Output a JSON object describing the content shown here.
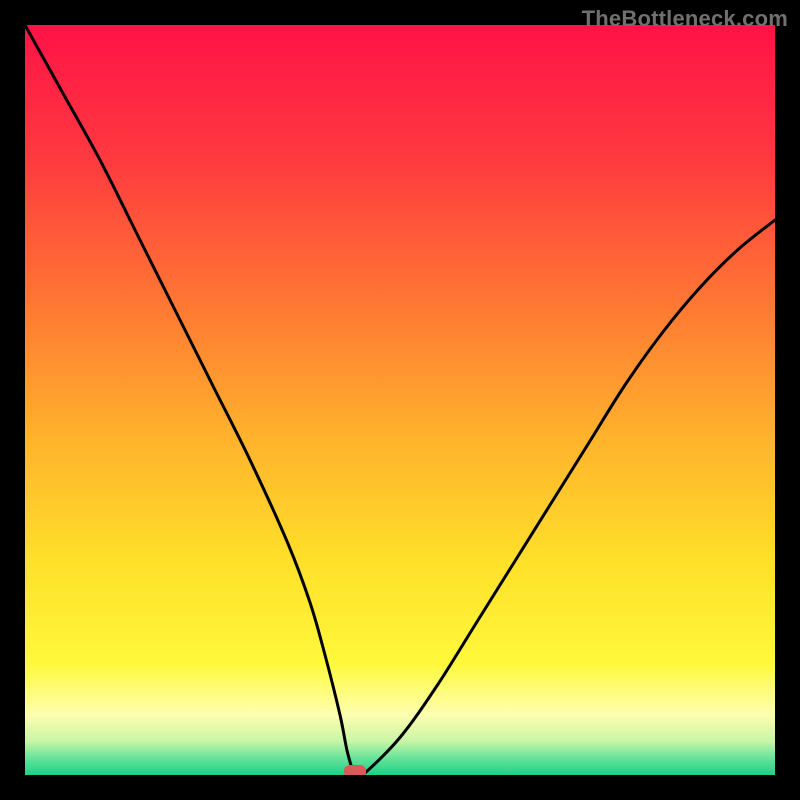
{
  "watermark": "TheBottleneck.com",
  "chart_data": {
    "type": "line",
    "title": "",
    "xlabel": "",
    "ylabel": "",
    "xlim": [
      0,
      100
    ],
    "ylim": [
      0,
      100
    ],
    "x": [
      0,
      5,
      10,
      15,
      20,
      25,
      30,
      35,
      38,
      40,
      42,
      43,
      44,
      45,
      50,
      55,
      60,
      65,
      70,
      75,
      80,
      85,
      90,
      95,
      100
    ],
    "values": [
      100,
      91,
      82,
      72,
      62,
      52,
      42,
      31,
      23,
      16,
      8,
      3,
      0,
      0,
      5,
      12,
      20,
      28,
      36,
      44,
      52,
      59,
      65,
      70,
      74
    ],
    "marker": {
      "x": 44,
      "y": 0
    },
    "gradient_stops": [
      {
        "pos": 0.0,
        "color": "#ff1247"
      },
      {
        "pos": 0.18,
        "color": "#ff3a3f"
      },
      {
        "pos": 0.38,
        "color": "#ff7a33"
      },
      {
        "pos": 0.55,
        "color": "#ffb22c"
      },
      {
        "pos": 0.72,
        "color": "#ffe12a"
      },
      {
        "pos": 0.85,
        "color": "#fff83a"
      },
      {
        "pos": 0.92,
        "color": "#fdffb0"
      },
      {
        "pos": 0.955,
        "color": "#c8f5a6"
      },
      {
        "pos": 0.978,
        "color": "#65e39a"
      },
      {
        "pos": 1.0,
        "color": "#1ecf86"
      }
    ]
  }
}
